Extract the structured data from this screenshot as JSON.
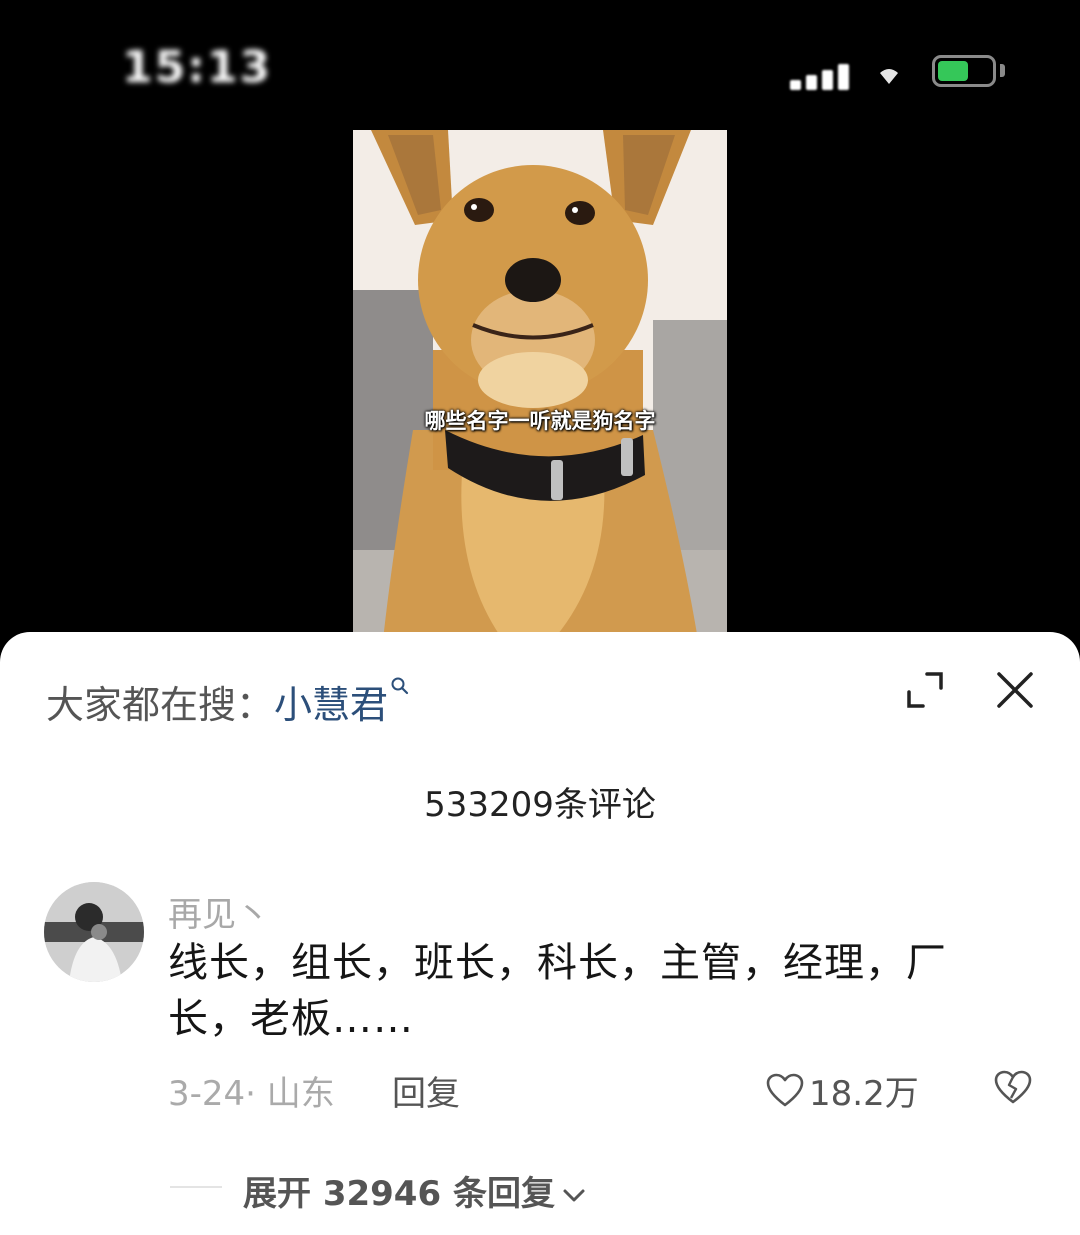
{
  "status_bar": {
    "time": "15:13",
    "battery_color": "#35c759"
  },
  "video": {
    "caption": "哪些名字一听就是狗名字"
  },
  "sheet": {
    "trending_prefix": "大家都在搜：",
    "trending_term": "小慧君",
    "trending_term_color": "#2c4f7a",
    "icons": [
      "search-icon",
      "expand-icon",
      "close-icon"
    ],
    "comment_count": "533209条评论"
  },
  "comment": {
    "username": "再见丶",
    "text": "线长，组长，班长，科长，主管，经理，厂长，老板……",
    "date_location": "3-24· 山东",
    "reply_label": "回复",
    "like_count": "18.2万",
    "expand_replies": "展开 32946 条回复"
  }
}
